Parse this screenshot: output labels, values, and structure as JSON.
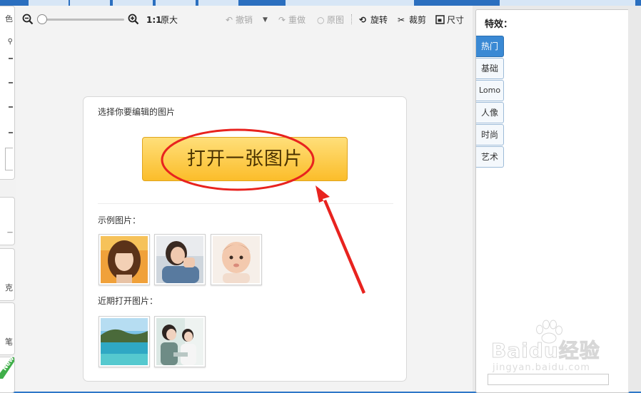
{
  "toolbar": {
    "zoom_out_icon": "zoom-out-icon",
    "zoom_in_icon": "zoom-in-icon",
    "ratio_label": "1:1",
    "original_size_label": "原大",
    "undo_label": "撤销",
    "redo_label": "重做",
    "restore_label": "原图",
    "rotate_label": "旋转",
    "crop_label": "裁剪",
    "size_label": "尺寸",
    "zoom_level": 0
  },
  "left_strip": {
    "panel1_glyph": "色",
    "panel2_glyph": "克",
    "panel3_glyph": "笔",
    "new_badge": "New"
  },
  "card": {
    "title": "选择你要编辑的图片",
    "open_button_label": "打开一张图片",
    "examples_label": "示例图片：",
    "recent_label": "近期打开图片："
  },
  "effects": {
    "title": "特效：",
    "tabs": [
      {
        "label": "热门",
        "active": true
      },
      {
        "label": "基础",
        "active": false
      },
      {
        "label": "Lomo",
        "active": false
      },
      {
        "label": "人像",
        "active": false
      },
      {
        "label": "时尚",
        "active": false
      },
      {
        "label": "艺术",
        "active": false
      }
    ]
  },
  "watermark": {
    "brand": "Baidu经验",
    "url": "jingyan.baidu.com"
  },
  "colors": {
    "accent": "#3a89d4",
    "button_top": "#ffdf7a",
    "button_bottom": "#fbbd2a",
    "annotation": "#e8231f"
  }
}
